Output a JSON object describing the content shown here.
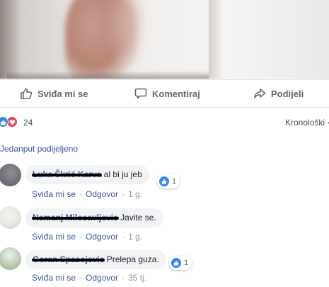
{
  "actions": {
    "like_label": "Sviđa mi se",
    "comment_label": "Komentiraj",
    "share_label": "Podijeli"
  },
  "reactions": {
    "count": "24",
    "sort_label": "Kronološki"
  },
  "shares": {
    "label": "Jedanput podijeljeno"
  },
  "comments": [
    {
      "author": "Luka Škrić Karva",
      "text": "al bi ju jeb",
      "likes": "1",
      "like_label": "Sviđa mi se",
      "reply_label": "Odgovor",
      "time": "1 g."
    },
    {
      "author": "Nemanj Milosavljevic",
      "text": "Javite se.",
      "like_label": "Sviđa mi se",
      "reply_label": "Odgovor",
      "time": "1 g."
    },
    {
      "author": "Goran Spasojevic",
      "text": "Prelepa guza.",
      "likes": "1",
      "like_label": "Sviđa mi se",
      "reply_label": "Odgovor",
      "time": "35 tj."
    }
  ],
  "colors": {
    "link_blue": "#385898",
    "like_blue": "#2d88ff",
    "love_red": "#f33e58",
    "muted_gray": "#606770",
    "bubble_bg": "#f2f3f5"
  }
}
